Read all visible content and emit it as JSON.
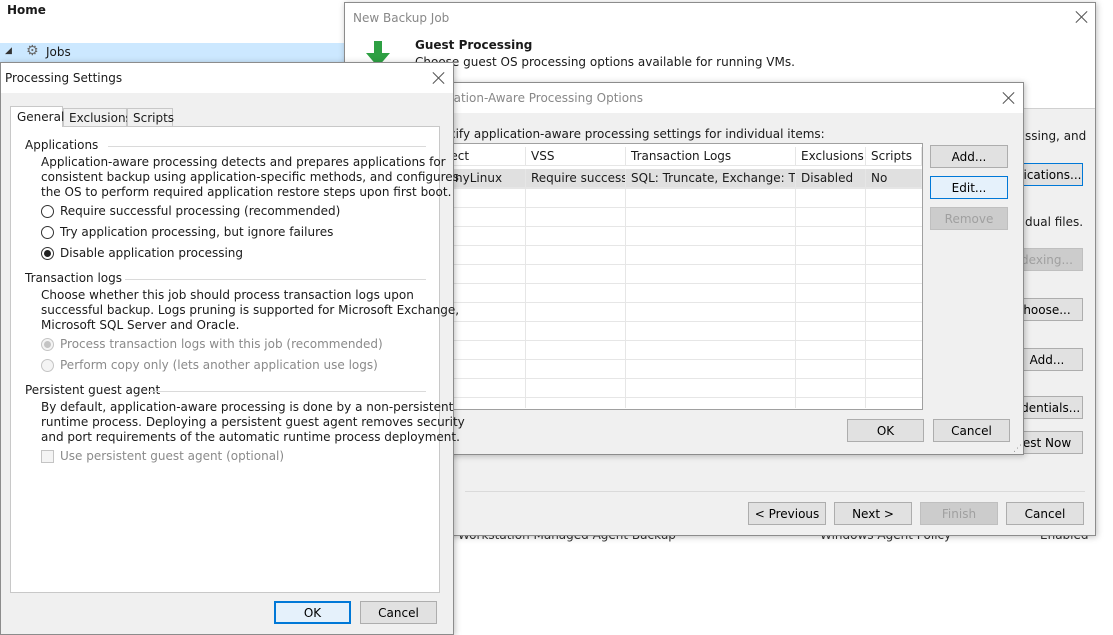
{
  "home": {
    "title": "Home",
    "tree_jobs": "Jobs"
  },
  "background_rows": {
    "left_text": "Workstation Managed Agent Backup",
    "mid_text": "Windows Agent Policy",
    "right_text": "Enabled"
  },
  "wizard": {
    "title": "New Backup Job",
    "step_title": "Guest Processing",
    "step_desc": "Choose guest OS processing options available for running VMs.",
    "right_texts": [
      "ssing, and",
      "dual files."
    ],
    "right_buttons": [
      "plications...",
      "dexing...",
      "hoose...",
      "Add...",
      "edentials...",
      "est Now"
    ],
    "footer": {
      "previous": "< Previous",
      "next": "Next >",
      "finish": "Finish",
      "cancel": "Cancel"
    }
  },
  "aap": {
    "title": "cation-Aware Processing Options",
    "instruction": "cify application-aware processing settings for individual items:",
    "columns": [
      "ject",
      "VSS",
      "Transaction Logs",
      "Exclusions",
      "Scripts"
    ],
    "rows": [
      [
        "tinyLinux",
        "Require success",
        "SQL: Truncate, Exchange: Tr...",
        "Disabled",
        "No"
      ]
    ],
    "buttons": {
      "add": "Add...",
      "edit": "Edit...",
      "remove": "Remove"
    },
    "ok": "OK",
    "cancel": "Cancel"
  },
  "ps": {
    "title": "Processing Settings",
    "tabs": [
      "General",
      "Exclusions",
      "Scripts"
    ],
    "applications": {
      "header": "Applications",
      "desc": [
        "Application-aware processing detects and prepares applications for",
        "consistent backup using application-specific methods, and configures",
        "the OS to perform required application restore steps upon first boot."
      ],
      "options": [
        "Require successful processing  (recommended)",
        "Try application processing, but ignore failures",
        "Disable application processing"
      ]
    },
    "transaction_logs": {
      "header": "Transaction logs",
      "desc": [
        "Choose whether this job should process transaction logs upon",
        "successful backup. Logs pruning is supported for Microsoft Exchange,",
        "Microsoft SQL Server and Oracle."
      ],
      "options": [
        "Process transaction logs with this job (recommended)",
        "Perform copy only (lets another application use logs)"
      ]
    },
    "agent": {
      "header": "Persistent guest agent",
      "desc": [
        "By default, application-aware processing is done by a non-persistent",
        "runtime process. Deploying a persistent guest agent removes security",
        "and port requirements of the automatic runtime process deployment."
      ],
      "checkbox": "Use persistent guest agent (optional)"
    },
    "ok": "OK",
    "cancel": "Cancel"
  },
  "colors": {
    "accent": "#0078d7",
    "selection": "#cce8ff",
    "dialog_bg": "#f0f0f0",
    "icon_green": "#2ea043"
  }
}
